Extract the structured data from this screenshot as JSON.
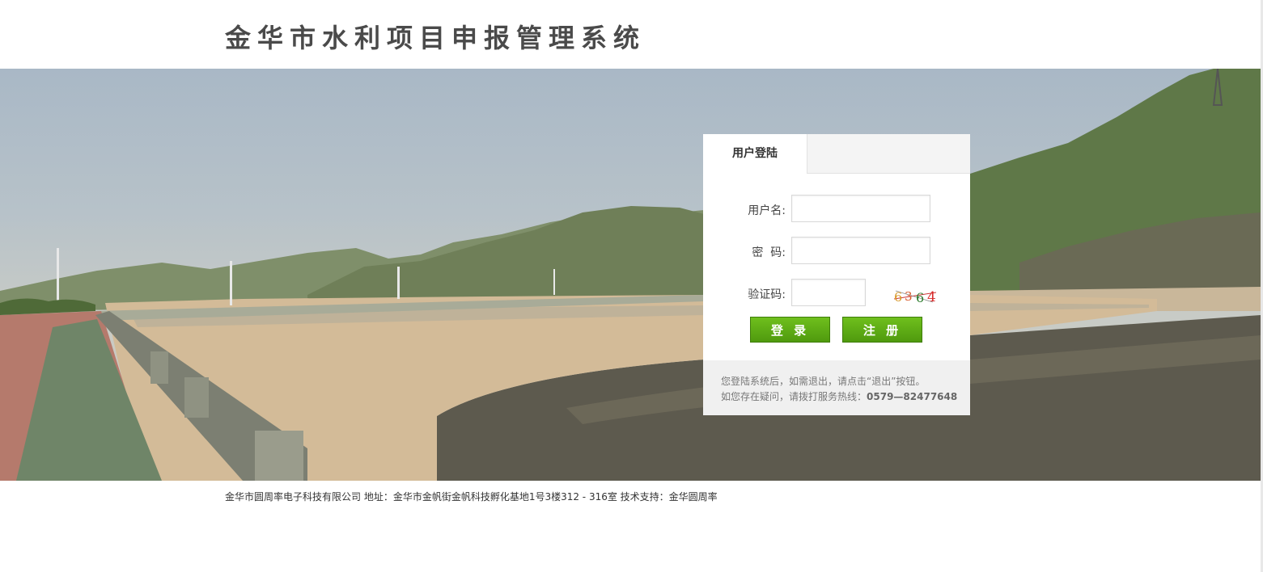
{
  "header": {
    "title": "金华市水利项目申报管理系统"
  },
  "login": {
    "tab_label": "用户登陆",
    "username_label": "用户名:",
    "password_label": "密  码:",
    "captcha_label": "验证码:",
    "username_value": "",
    "password_value": "",
    "captcha_value": "",
    "captcha_chars": [
      "6",
      "3",
      "6",
      "4"
    ],
    "login_button": "登 录",
    "register_button": "注 册",
    "notice_line1": "您登陆系统后，如需退出，请点击“退出”按钮。",
    "notice_line2_prefix": "如您存在疑问，请拨打服务热线：",
    "hotline": "0579—82477648"
  },
  "footer": {
    "text": "金华市圆周率电子科技有限公司 地址：金华市金帆街金帆科技孵化基地1号3楼312 - 316室 技术支持：金华圆周率"
  },
  "colors": {
    "button_green": "#5aa814",
    "title_gray": "#4a4a4a",
    "water": "#5d5a4e"
  }
}
